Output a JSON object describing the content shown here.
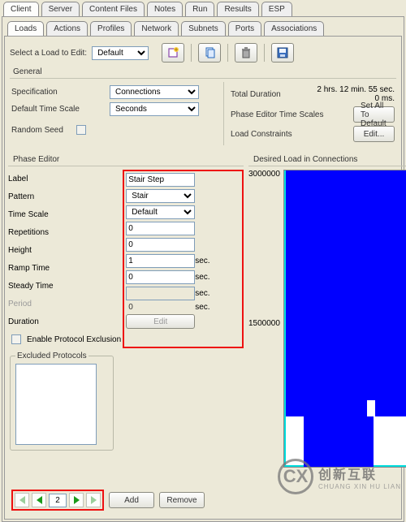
{
  "main_tabs": [
    "Client",
    "Server",
    "Content Files",
    "Notes",
    "Run",
    "Results",
    "ESP"
  ],
  "main_tab_active": 0,
  "sub_tabs": [
    "Loads",
    "Actions",
    "Profiles",
    "Network",
    "Subnets",
    "Ports",
    "Associations"
  ],
  "sub_tab_active": 0,
  "toolbar": {
    "select_label": "Select a Load to Edit:",
    "select_value": "Default"
  },
  "general": {
    "title": "General",
    "spec_label": "Specification",
    "spec_value": "Connections",
    "timescale_label": "Default Time Scale",
    "timescale_value": "Seconds",
    "random_label": "Random Seed",
    "total_dur_label": "Total Duration",
    "total_dur_value": "2 hrs. 12 min. 55 sec. 0 ms.",
    "petime_label": "Phase Editor Time Scales",
    "set_all_btn": "Set All To Default",
    "load_con_label": "Load Constraints",
    "edit_btn": "Edit..."
  },
  "phase_editor": {
    "title": "Phase Editor",
    "label_label": "Label",
    "label_value": "Stair Step",
    "pattern_label": "Pattern",
    "pattern_value": "Stair",
    "timescale_label": "Time Scale",
    "timescale_value": "Default",
    "repetitions_label": "Repetitions",
    "repetitions_value": "0",
    "height_label": "Height",
    "height_value": "0",
    "ramp_label": "Ramp Time",
    "ramp_value": "1",
    "ramp_unit": "sec.",
    "steady_label": "Steady Time",
    "steady_value": "0",
    "steady_unit": "sec.",
    "period_label": "Period",
    "period_value": "",
    "period_unit": "sec.",
    "duration_label": "Duration",
    "duration_value": "0",
    "duration_unit": "sec.",
    "enable_excl_label": "Enable Protocol Exclusion",
    "edit_btn": "Edit",
    "excluded_title": "Excluded Protocols"
  },
  "nav": {
    "page_value": "2",
    "add_btn": "Add",
    "remove_btn": "Remove"
  },
  "chart": {
    "title": "Desired Load in Connections"
  },
  "chart_data": {
    "type": "area",
    "title": "Desired Load in Connections",
    "xlabel": "",
    "ylabel": "",
    "ylim": [
      0,
      3000000
    ],
    "yticks": [
      3000000,
      1500000
    ],
    "series": [
      {
        "name": "Desired Load",
        "values_approx": [
          3000000,
          3000000,
          2200000,
          1500000,
          1500000
        ]
      }
    ]
  },
  "watermark": {
    "zh": "创新互联",
    "en": "CHUANG XIN HU LIAN"
  }
}
